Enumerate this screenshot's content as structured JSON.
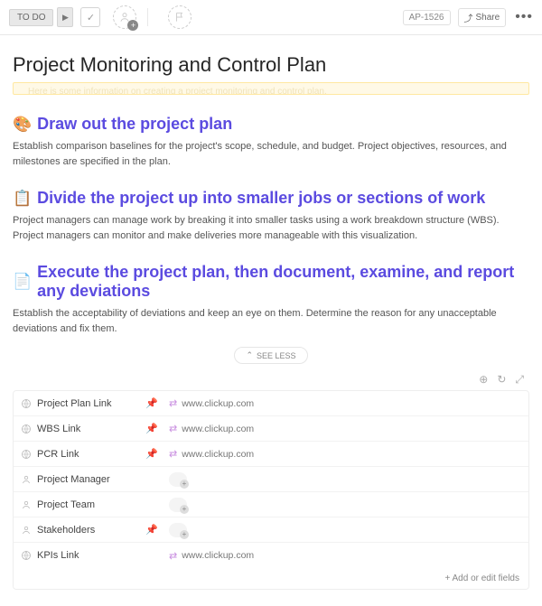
{
  "toolbar": {
    "status_label": "TO DO",
    "ticket_id": "AP-1526",
    "share_label": "Share"
  },
  "title": "Project Monitoring and Control Plan",
  "banner_text": "Here is some information on creating a project monitoring and control plan.",
  "sections": [
    {
      "emoji": "🎨",
      "heading": "Draw out the project plan",
      "body": "Establish comparison baselines for the project's scope, schedule, and budget. Project objectives, resources, and milestones are specified in the plan."
    },
    {
      "emoji": "📋",
      "heading": "Divide the project up into smaller jobs or sections of work",
      "body": "Project managers can manage work by breaking it into smaller tasks using a work breakdown structure (WBS). Project managers can monitor and make deliveries more manageable with this visualization."
    },
    {
      "emoji": "📄",
      "heading": "Execute the project plan, then document, examine, and report any deviations",
      "body": "Establish the acceptability of deviations and keep an eye on them. Determine the reason for any unacceptable deviations and fix them."
    }
  ],
  "see_less_label": "SEE LESS",
  "fields": [
    {
      "icon": "globe",
      "name": "Project Plan Link",
      "pinned": true,
      "value_type": "link",
      "value": "www.clickup.com"
    },
    {
      "icon": "globe",
      "name": "WBS Link",
      "pinned": true,
      "value_type": "link",
      "value": "www.clickup.com"
    },
    {
      "icon": "globe",
      "name": "PCR Link",
      "pinned": true,
      "value_type": "link",
      "value": "www.clickup.com"
    },
    {
      "icon": "person",
      "name": "Project Manager",
      "pinned": false,
      "value_type": "empty",
      "value": ""
    },
    {
      "icon": "person",
      "name": "Project Team",
      "pinned": false,
      "value_type": "empty",
      "value": ""
    },
    {
      "icon": "person",
      "name": "Stakeholders",
      "pinned": true,
      "value_type": "empty",
      "value": ""
    },
    {
      "icon": "globe",
      "name": "KPIs Link",
      "pinned": false,
      "value_type": "link",
      "value": "www.clickup.com"
    }
  ],
  "add_fields_label": "+ Add or edit fields"
}
